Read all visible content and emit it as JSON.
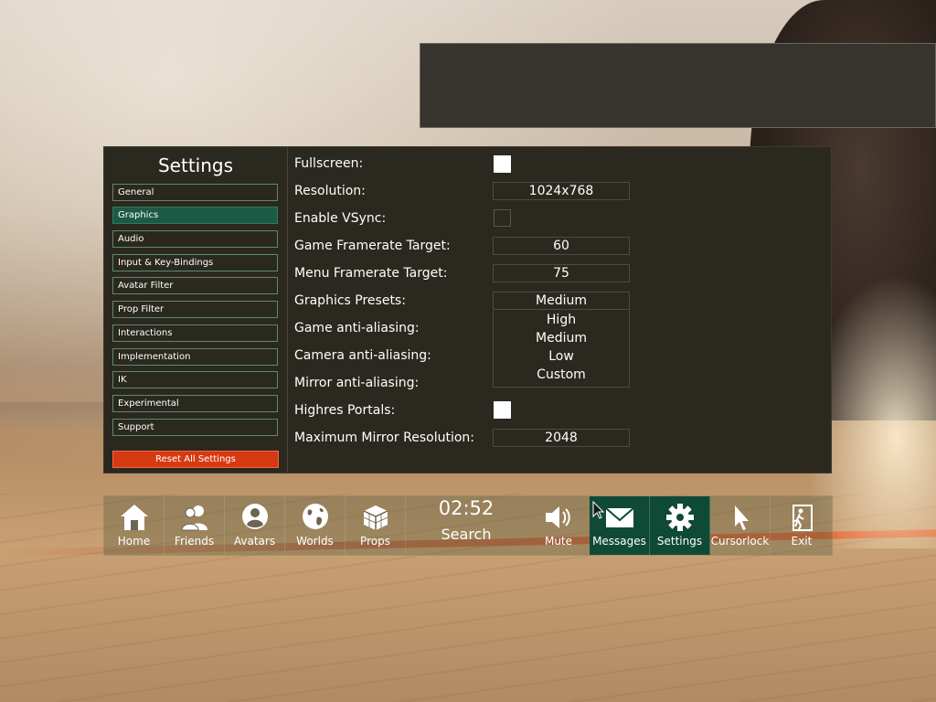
{
  "settings": {
    "title": "Settings",
    "nav": [
      {
        "label": "General"
      },
      {
        "label": "Graphics"
      },
      {
        "label": "Audio"
      },
      {
        "label": "Input & Key-Bindings"
      },
      {
        "label": "Avatar Filter"
      },
      {
        "label": "Prop Filter"
      },
      {
        "label": "Interactions"
      },
      {
        "label": "Implementation"
      },
      {
        "label": "IK"
      },
      {
        "label": "Experimental"
      },
      {
        "label": "Support"
      }
    ],
    "active_nav": "Graphics",
    "reset_label": "Reset All Settings"
  },
  "graphics": {
    "fullscreen": {
      "label": "Fullscreen:",
      "checked": true
    },
    "resolution": {
      "label": "Resolution:",
      "value": "1024x768"
    },
    "vsync": {
      "label": "Enable VSync:",
      "checked": false
    },
    "game_framerate": {
      "label": "Game Framerate Target:",
      "value": "60"
    },
    "menu_framerate": {
      "label": "Menu Framerate Target:",
      "value": "75"
    },
    "presets": {
      "label": "Graphics Presets:",
      "value": "Medium",
      "options": [
        "High",
        "Medium",
        "Low",
        "Custom"
      ]
    },
    "game_aa": {
      "label": "Game anti-aliasing:"
    },
    "camera_aa": {
      "label": "Camera anti-aliasing:"
    },
    "mirror_aa": {
      "label": "Mirror anti-aliasing:"
    },
    "highres_portals": {
      "label": "Highres Portals:",
      "checked": true
    },
    "mirror_resolution": {
      "label": "Maximum Mirror Resolution:",
      "value": "2048"
    }
  },
  "bottom_bar": {
    "home": "Home",
    "friends": "Friends",
    "avatars": "Avatars",
    "worlds": "Worlds",
    "props": "Props",
    "clock": "02:52",
    "search": "Search",
    "mute": "Mute",
    "messages": "Messages",
    "settings": "Settings",
    "cursorlock": "Cursorlock",
    "exit": "Exit"
  },
  "colors": {
    "panel": "#2b281f",
    "active_tab": "#1d5a45",
    "reset": "#d63a12",
    "active_nav": "#0f4a37"
  }
}
